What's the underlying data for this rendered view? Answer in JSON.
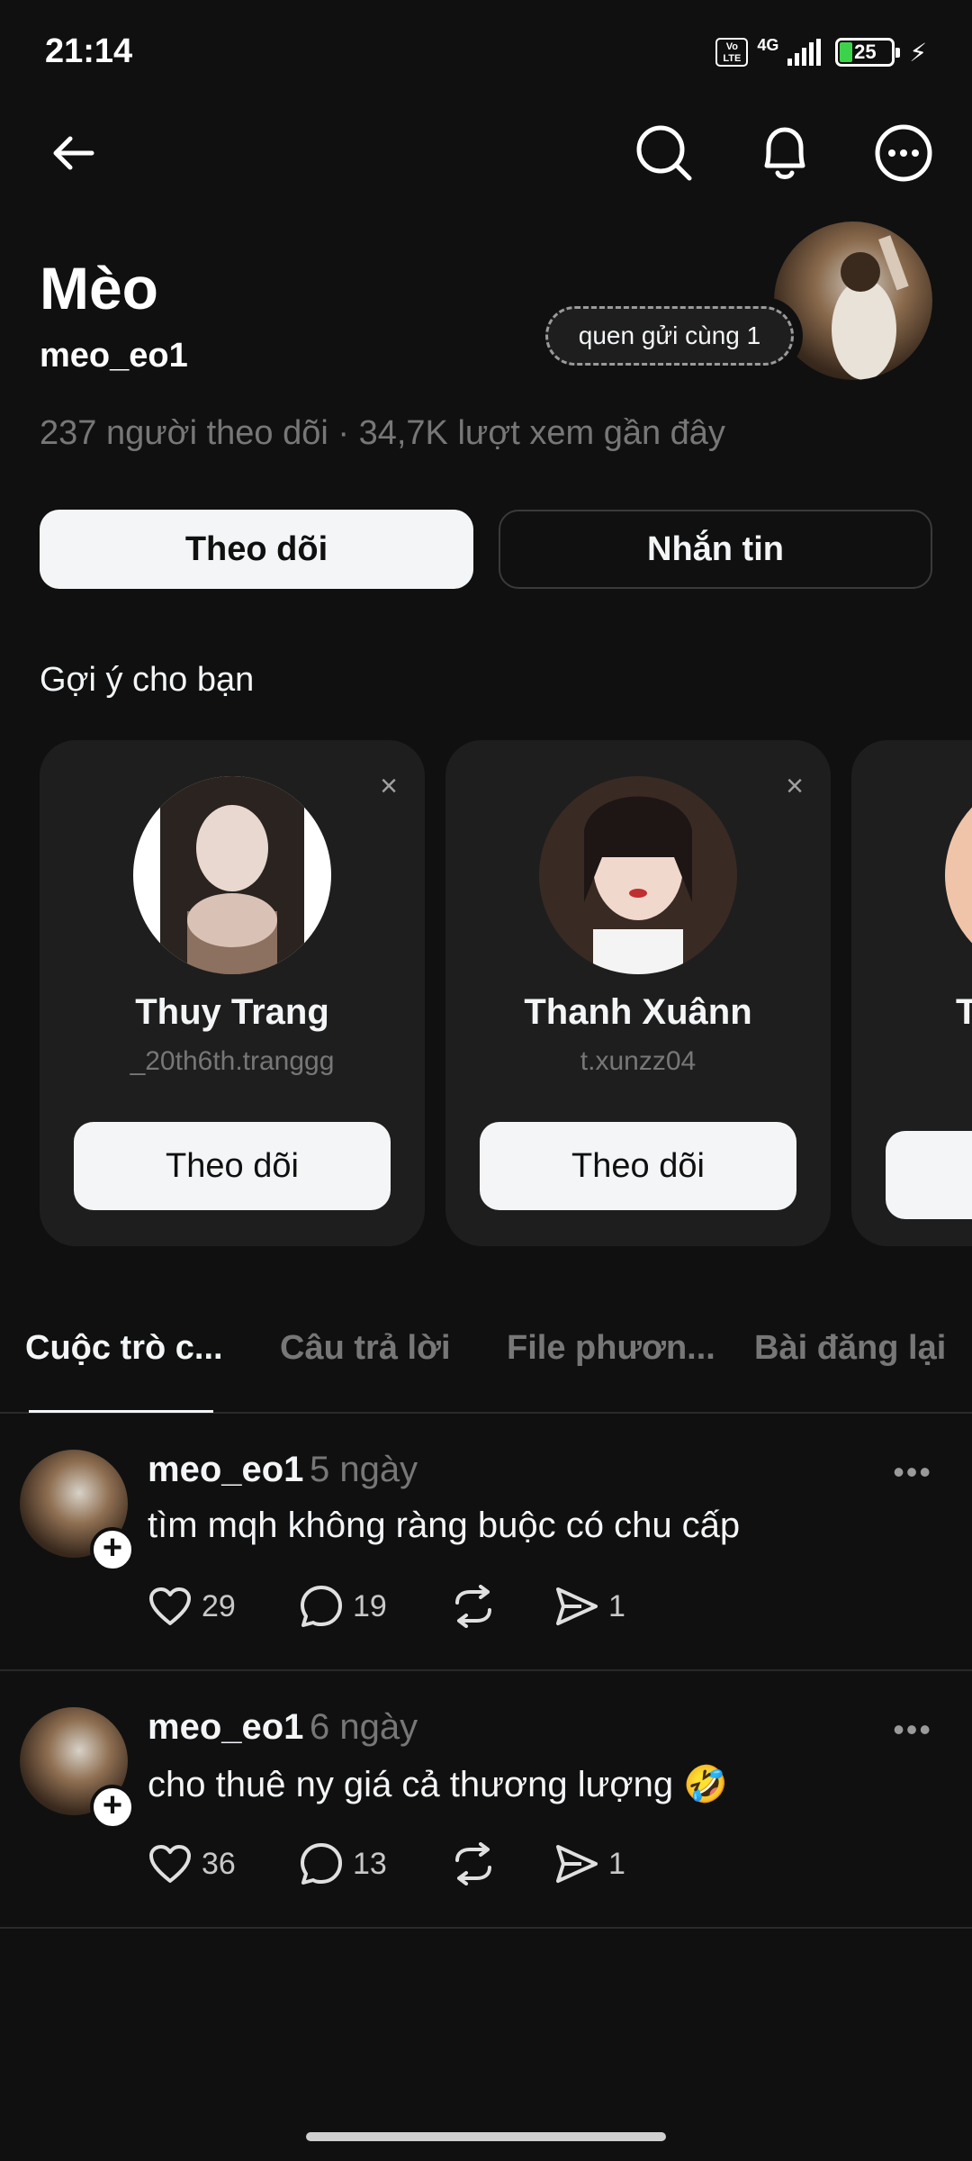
{
  "status_bar": {
    "time": "21:14",
    "volte": "Vo LTE",
    "network": "4G",
    "battery": "25",
    "battery_level_percent": 25
  },
  "nav": {
    "back_icon": "arrow-left-icon",
    "search_icon": "search-icon",
    "notification_icon": "bell-icon",
    "more_icon": "more-circle-icon"
  },
  "profile": {
    "name": "Mèo",
    "handle": "meo_eo1",
    "mutual_label": "quen gửi cùng 1",
    "stats": "237 người theo dõi · 34,7K lượt xem gần đây",
    "follow_label": "Theo dõi",
    "message_label": "Nhắn tin"
  },
  "suggestions": {
    "title": "Gợi ý cho bạn",
    "close_symbol": "×",
    "items": [
      {
        "name": "Thuy Trang",
        "handle": "_20th6th.tranggg",
        "follow_label": "Theo dõi"
      },
      {
        "name": "Thanh Xuânn",
        "handle": "t.xunzz04",
        "follow_label": "Theo dõi"
      },
      {
        "name": "T",
        "handle": "",
        "follow_label": ""
      }
    ]
  },
  "tabs": [
    {
      "label": "Cuộc trò c...",
      "active": true
    },
    {
      "label": "Câu trả lời",
      "active": false
    },
    {
      "label": "File phươn...",
      "active": false
    },
    {
      "label": "Bài đăng lại",
      "active": false
    }
  ],
  "posts": [
    {
      "user": "meo_eo1",
      "time": "5 ngày",
      "text": "tìm mqh không ràng buộc có chu cấp",
      "likes": "29",
      "comments": "19",
      "shares": "1"
    },
    {
      "user": "meo_eo1",
      "time": "6 ngày",
      "text": "cho thuê ny giá cả thương lượng 🤣",
      "likes": "36",
      "comments": "13",
      "shares": "1"
    }
  ],
  "colors": {
    "background": "#101010",
    "card": "#1e1e1e",
    "primary_text": "#f3f5f7",
    "secondary_text": "#777777",
    "battery_green": "#3cd34a"
  }
}
